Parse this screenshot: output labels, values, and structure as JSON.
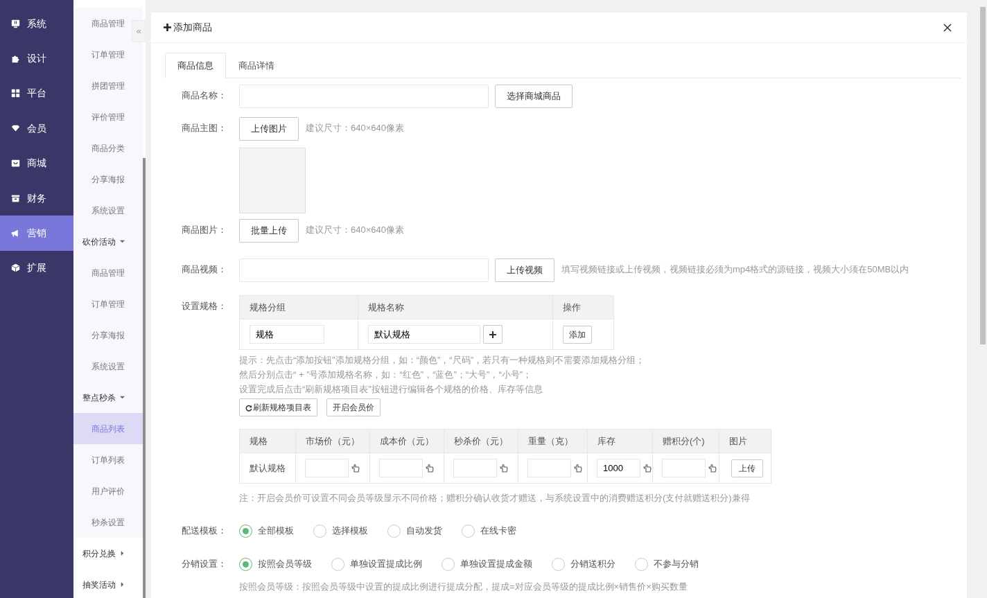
{
  "main_menu": [
    {
      "label": "系统",
      "selected": false
    },
    {
      "label": "设计",
      "selected": false
    },
    {
      "label": "平台",
      "selected": false
    },
    {
      "label": "会员",
      "selected": false
    },
    {
      "label": "商城",
      "selected": false
    },
    {
      "label": "财务",
      "selected": false
    },
    {
      "label": "营销",
      "selected": true
    },
    {
      "label": "扩展",
      "selected": false
    }
  ],
  "sub_menu": [
    {
      "kind": "link",
      "label": "商品管理",
      "selected": false
    },
    {
      "kind": "link",
      "label": "订单管理",
      "selected": false
    },
    {
      "kind": "link",
      "label": "拼团管理",
      "selected": false
    },
    {
      "kind": "link",
      "label": "评价管理",
      "selected": false
    },
    {
      "kind": "link",
      "label": "商品分类",
      "selected": false
    },
    {
      "kind": "link",
      "label": "分享海报",
      "selected": false
    },
    {
      "kind": "link",
      "label": "系统设置",
      "selected": false
    },
    {
      "kind": "group",
      "label": "砍价活动",
      "expanded": true,
      "children": [
        {
          "label": "商品管理",
          "selected": false
        },
        {
          "label": "订单管理",
          "selected": false
        },
        {
          "label": "分享海报",
          "selected": false
        },
        {
          "label": "系统设置",
          "selected": false
        }
      ]
    },
    {
      "kind": "group",
      "label": "整点秒杀",
      "expanded": true,
      "children": [
        {
          "label": "商品列表",
          "selected": true
        },
        {
          "label": "订单列表",
          "selected": false
        },
        {
          "label": "用户评价",
          "selected": false
        },
        {
          "label": "秒杀设置",
          "selected": false
        }
      ]
    },
    {
      "kind": "group",
      "label": "积分兑换",
      "expanded": false
    },
    {
      "kind": "group",
      "label": "抽奖活动",
      "expanded": false
    }
  ],
  "collapse_button": "«",
  "dialog": {
    "title": "添加商品",
    "tabs": [
      {
        "label": "商品信息",
        "selected": true
      },
      {
        "label": "商品详情",
        "selected": false
      }
    ],
    "name_row": {
      "label": "商品名称：",
      "button": "选择商城商品"
    },
    "main_image_row": {
      "label": "商品主图：",
      "button": "上传图片",
      "hint": "建议尺寸：640×640像素"
    },
    "images_row": {
      "label": "商品图片：",
      "button": "批量上传",
      "hint": "建议尺寸：640×640像素"
    },
    "video_row": {
      "label": "商品视频：",
      "button": "上传视频",
      "hint": "填写视频链接或上传视频，视频链接必须为mp4格式的源链接，视频大小须在50MB以内"
    },
    "spec_row": {
      "label": "设置规格：",
      "columns": [
        "规格分组",
        "规格名称",
        "操作"
      ],
      "group_value": "规格",
      "name_value": "默认规格",
      "add_button": "添加",
      "tips": [
        "提示：先点击“添加按钮”添加规格分组，如：“颜色”，“尺码”，若只有一种规格则不需要添加规格分组；",
        "然后分别点击“ + ”号添加规格名称，如：“红色”，“蓝色”；“大号”，“小号”；",
        "设置完成后点击“刷新规格项目表”按钮进行编辑各个规格的价格、库存等信息"
      ],
      "buttons": [
        "刷新规格项目表",
        "开启会员价"
      ]
    },
    "price_table": {
      "columns": [
        "规格",
        "市场价（元）",
        "成本价（元）",
        "秒杀价（元）",
        "重量（克）",
        "库存",
        "赠积分(个)",
        "图片"
      ],
      "rows": [
        {
          "cells": [
            {
              "kind": "text",
              "value": "默认规格"
            },
            {
              "kind": "input"
            },
            {
              "kind": "input"
            },
            {
              "kind": "input"
            },
            {
              "kind": "input"
            },
            {
              "kind": "input",
              "value": "1000"
            },
            {
              "kind": "input"
            },
            {
              "kind": "button",
              "label": "上传"
            }
          ]
        }
      ],
      "note": "注：开启会员价可设置不同会员等级显示不同价格；赠积分确认收货才赠送，与系统设置中的消费赠送积分(支付就赠送积分)兼得"
    },
    "delivery": {
      "label": "配送模板：",
      "options": [
        {
          "label": "全部模板",
          "selected": true
        },
        {
          "label": "选择模板",
          "selected": false
        },
        {
          "label": "自动发货",
          "selected": false
        },
        {
          "label": "在线卡密",
          "selected": false
        }
      ]
    },
    "distribution": {
      "label": "分销设置：",
      "options": [
        {
          "label": "按照会员等级",
          "selected": true
        },
        {
          "label": "单独设置提成比例",
          "selected": false
        },
        {
          "label": "单独设置提成金额",
          "selected": false
        },
        {
          "label": "分销送积分",
          "selected": false
        },
        {
          "label": "不参与分销",
          "selected": false
        }
      ],
      "descriptions": [
        "按照会员等级：按照会员等级中设置的提成比例进行提成分配，提成=对应会员等级的提成比例×销售价×购买数量"
      ]
    }
  }
}
